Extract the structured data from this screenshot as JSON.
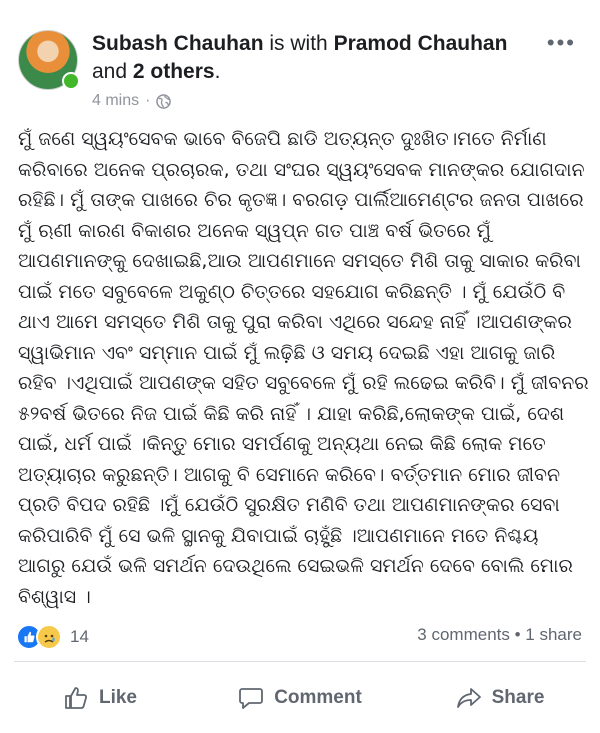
{
  "post": {
    "author": "Subash Chauhan",
    "with_text": "is with",
    "tagged": "Pramod Chauhan",
    "and_text": "and",
    "others": "2 others",
    "time": "4 mins",
    "dot": "·",
    "privacy_icon": "globe-icon",
    "menu_icon": "more-options-icon",
    "body": "ମୁଁ ଜଣେ ସ୍ୱୟଂସେବକ ଭାବେ ବିଜେପି ଛାଡି ଅତ୍ୟନ୍ତ ଦୁଃଖିତ।ମତେ ନିର୍ମାଣ କରିବାରେ ଅନେକ ପ୍ରଚାରକ, ତଥା ସଂଘର ସ୍ୱୟଂସେବକ ମାନଙ୍କର ଯୋଗଦାନ ରହିଛି। ମୁଁ ତାଙ୍କ ପାଖରେ ଚିର କୃତଜ୍ଞ। ବରଗଡ଼ ପାର୍ଲିଆମେଣ୍ଟର ଜନତା ପାଖରେ ମୁଁ ଋଣୀ କାରଣ ବିକାଶର ଅନେକ ସ୍ୱପ୍ନ ଗତ ପାଞ୍ଚ ବର୍ଷ ଭିତରେ ମୁଁ ଆପଣମାନଙ୍କୁ ଦେଖାଇଛି,ଆଉ ଆପଣମାନେ ସମସ୍ତେ ମିଶି ତାକୁ ସାକାର କରିବା ପାଇଁ ମତେ ସବୁବେଳେ ଅକୁଣ୍ଠ ଚିତ୍ତରେ ସହଯୋଗ କରିଛନ୍ତି । ମୁଁ ଯେଉଁଠି ବି ଥାଏ ଆମେ ସମସ୍ତେ ମିଶି ତାକୁ ପୁରା କରିବା ଏଥିରେ ସନ୍ଦେହ ନାହିଁ ।ଆପଣଙ୍କର ସ୍ୱାଭିମାନ ଏବଂ ସମ୍ମାନ ପାଇଁ ମୁଁ ଲଢ଼ିଛି ଓ ସମୟ ଦେଇଛି ଏହା ଆଗକୁ ଜାରି ରହିବ ।ଏଥିପାଇଁ ଆପଣଙ୍କ ସହିତ ସବୁବେଳେ ମୁଁ ରହି ଲଢେଇ କରିବି। ମୁଁ ଜୀବନର ୫୨ବର୍ଷ ଭିତରେ ନିଜ ପାଇଁ କିଛି କରି ନାହିଁ । ଯାହା କରିଛି,ଲୋକଙ୍କ ପାଇଁ, ଦେଶ ପାଇଁ, ଧର୍ମ ପାଇଁ ।କିନ୍ତୁ ମୋର ସମର୍ପଣକୁ ଅନ୍ୟଥା ନେଇ କିଛି ଲୋକ ମତେ ଅତ୍ୟାଚାର କରୁଛନ୍ତି। ଆଗକୁ ବି ସେମାନେ କରିବେ। ବର୍ତ୍ତମାନ ମୋର ଜୀବନ ପ୍ରତି ବିପଦ ରହିଛି ।ମୁଁ ଯେଉଁଠି ସୁରକ୍ଷିତ ମଣିବି ତଥା ଆପଣମାନଙ୍କର ସେବା କରିପାରିବି ମୁଁ ସେ ଭଳି ସ୍ଥାନକୁ ଯିବାପାଇଁ ଚାହୁଁଛି ।ଆପଣମାନେ ମତେ ନିଶ୍ଚୟ ଆଗରୁ ଯେଉଁ ଭଳି ସମର୍ଥନ ଦେଉଥିଲେ ସେଇଭଳି ସମର୍ଥନ ଦେବେ ବୋଲି ମୋର ବିଶ୍ୱାସ ।"
  },
  "reactions": {
    "icons": [
      "like-reaction-icon",
      "sad-reaction-icon"
    ],
    "count": "14",
    "comments": "3 comments",
    "sep": "•",
    "shares": "1 share"
  },
  "actions": {
    "like": "Like",
    "comment": "Comment",
    "share": "Share"
  },
  "colors": {
    "like_blue": "#1877f2",
    "sad_yellow": "#f7c94a",
    "meta_gray": "#90949c",
    "action_gray": "#606770"
  }
}
